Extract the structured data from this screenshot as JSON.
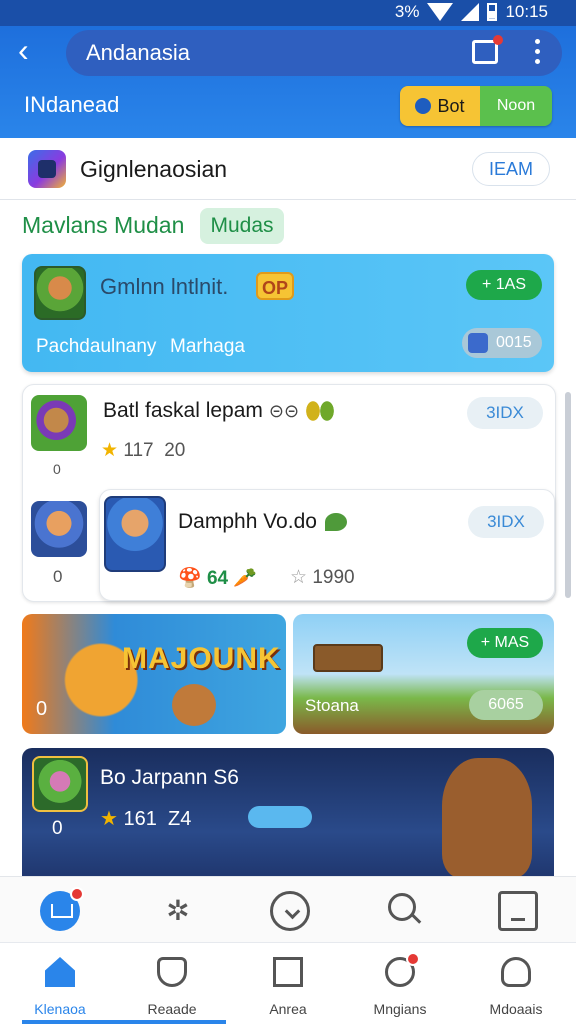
{
  "status_bar": {
    "battery": "3%",
    "time": "10:15"
  },
  "app_bar": {
    "back_icon": "chevron-left-icon",
    "title": "Andanasia",
    "subtitle": "INdanead",
    "toggle_left": "Bot",
    "toggle_right": "Noon"
  },
  "header": {
    "name": "Gignlenaosian",
    "action": "IEAM"
  },
  "section": {
    "title": "Mavlans Mudan",
    "chip": "Mudas"
  },
  "featured": {
    "title": "Gmlnn lntlnit.",
    "badge": "OP",
    "pill": "+ 1AS",
    "text_left": "Pachdaulnany",
    "text_right": "Marhaga",
    "count": "0015"
  },
  "list": {
    "row1": {
      "name": "Batl faskal lepam",
      "icons": "⊝⊝",
      "rating": "117",
      "count": "20",
      "action": "3IDX",
      "index": "0"
    },
    "row2": {
      "name": "Damphh Vo.do",
      "stat_a": "64",
      "stat_b": "1990",
      "action": "3IDX",
      "index": "0"
    }
  },
  "banners": [
    {
      "title": "MAJOUNK",
      "index": "0"
    },
    {
      "name": "Stoana",
      "pill": "+ MAS",
      "count": "6065"
    }
  ],
  "big_card": {
    "name": "Bo Jarpann S6",
    "rating": "161",
    "count": "Z4",
    "index": "0"
  },
  "tabs": [
    {
      "label": "Klenaoa",
      "icon": "home-icon"
    },
    {
      "label": "Reaade",
      "icon": "shield-icon"
    },
    {
      "label": "Anrea",
      "icon": "book-icon"
    },
    {
      "label": "Mngians",
      "icon": "chat-icon"
    },
    {
      "label": "Mdoaais",
      "icon": "person-icon"
    }
  ],
  "colors": {
    "primary": "#2a85ea",
    "accent_green": "#1ea84a",
    "badge_red": "#e53935",
    "gold": "#f6c434"
  }
}
